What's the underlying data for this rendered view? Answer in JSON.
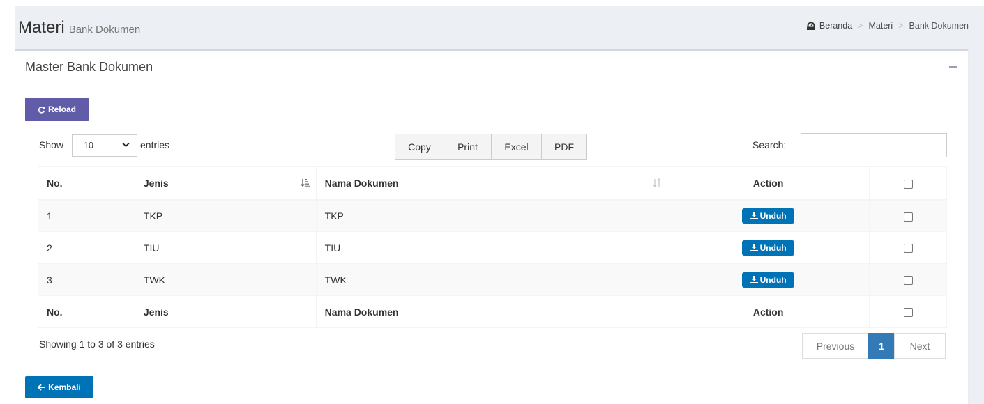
{
  "header": {
    "title": "Materi",
    "subtitle": "Bank Dokumen",
    "breadcrumb": [
      "Beranda",
      "Materi",
      "Bank Dokumen"
    ]
  },
  "box": {
    "title": "Master Bank Dokumen",
    "reload_label": "Reload",
    "back_label": "Kembali"
  },
  "datatable": {
    "show_label": "Show",
    "entries_label": "entries",
    "page_length": "10",
    "export_buttons": [
      "Copy",
      "Print",
      "Excel",
      "PDF"
    ],
    "search_label": "Search:",
    "search_value": "",
    "columns": [
      "No.",
      "Jenis",
      "Nama Dokumen",
      "Action"
    ],
    "rows": [
      {
        "no": "1",
        "jenis": "TKP",
        "nama": "TKP",
        "action": "Unduh"
      },
      {
        "no": "2",
        "jenis": "TIU",
        "nama": "TIU",
        "action": "Unduh"
      },
      {
        "no": "3",
        "jenis": "TWK",
        "nama": "TWK",
        "action": "Unduh"
      }
    ],
    "info": "Showing 1 to 3 of 3 entries",
    "pagination": {
      "previous": "Previous",
      "current": "1",
      "next": "Next"
    }
  },
  "colors": {
    "reload_button": "#605ca8",
    "action_button": "#0073b7",
    "page_active": "#337ab7",
    "background": "#ecf0f5"
  },
  "icons": {
    "breadcrumb": "dashboard-icon",
    "reload": "refresh-icon",
    "unduh": "download-icon",
    "kembali": "arrow-left-icon",
    "box_tool": "minus-icon"
  }
}
